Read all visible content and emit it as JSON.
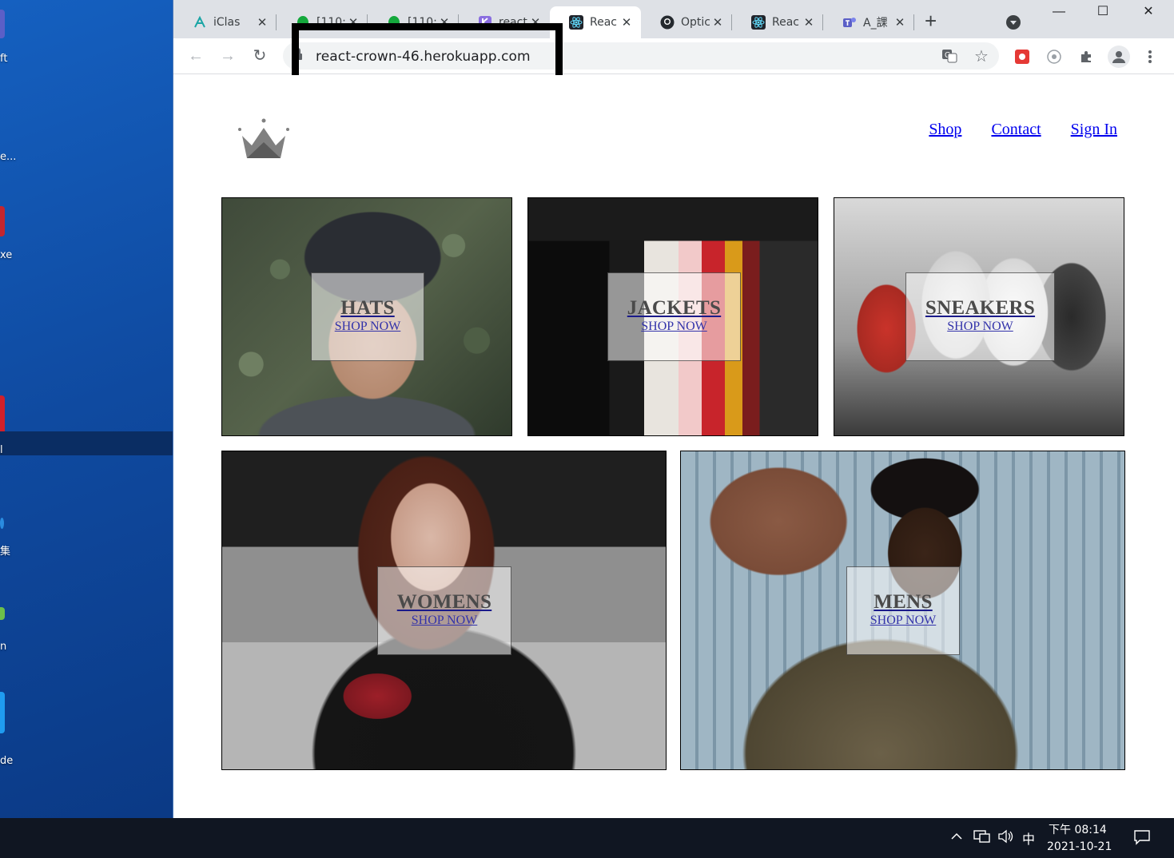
{
  "desktop": {
    "labels": [
      "ft",
      "e...",
      "xe",
      "l",
      "集",
      "n",
      "de"
    ]
  },
  "browser": {
    "tabs": [
      {
        "title": "iClas",
        "icon": "iclass-icon"
      },
      {
        "title": "[110:",
        "icon": "evernote-icon"
      },
      {
        "title": "[110:",
        "icon": "evernote-icon"
      },
      {
        "title": "react",
        "icon": "kotlin-icon"
      },
      {
        "title": "Reac",
        "icon": "react-icon",
        "active": true
      },
      {
        "title": "Optic",
        "icon": "github-icon"
      },
      {
        "title": "Reac",
        "icon": "react-icon"
      },
      {
        "title": "A_課",
        "icon": "teams-icon"
      }
    ],
    "new_tab": "+",
    "window_controls": {
      "minimize": "—",
      "maximize": "☐",
      "close": "✕"
    },
    "url": "react-crown-46.herokuapp.com"
  },
  "site": {
    "nav": {
      "shop": "Shop",
      "contact": "Contact",
      "sign_in": "Sign In"
    },
    "categories": [
      {
        "title": "HATS",
        "subtitle": "SHOP NOW"
      },
      {
        "title": "JACKETS",
        "subtitle": "SHOP NOW"
      },
      {
        "title": "SNEAKERS",
        "subtitle": "SHOP NOW"
      },
      {
        "title": "WOMENS",
        "subtitle": "SHOP NOW"
      },
      {
        "title": "MENS",
        "subtitle": "SHOP NOW"
      }
    ]
  },
  "taskbar": {
    "ime": "中",
    "time": "下午 08:14",
    "date": "2021-10-21"
  }
}
